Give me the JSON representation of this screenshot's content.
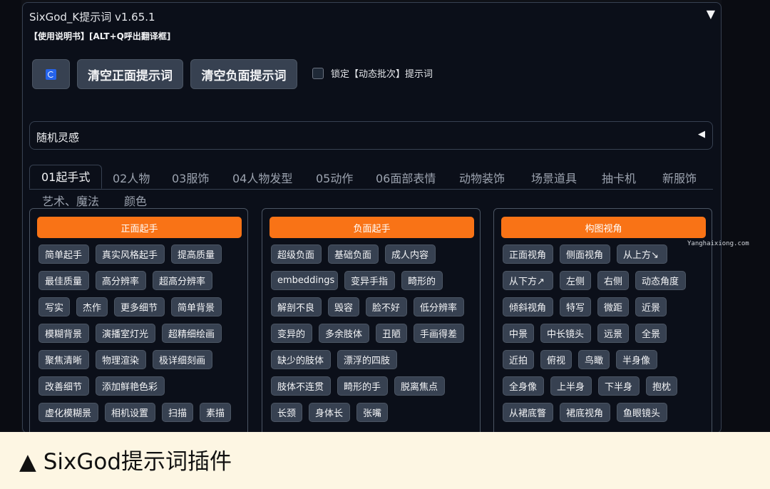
{
  "panel": {
    "title": "SixGod_K提示词 v1.65.1",
    "toggle_icon": "▼",
    "manual": "【使用说明书】[ALT+Q呼出翻译框]"
  },
  "toolbar": {
    "refresh_icon": "refresh-icon",
    "clear_positive": "清空正面提示词",
    "clear_negative": "清空负面提示词",
    "lock_label": "锁定【动态批次】提示词"
  },
  "random": {
    "label": "随机灵感",
    "arrow": "◀"
  },
  "tabs": [
    {
      "label": "01起手式"
    },
    {
      "label": "02人物"
    },
    {
      "label": "03服饰"
    },
    {
      "label": "04人物发型"
    },
    {
      "label": "05动作"
    },
    {
      "label": "06面部表情"
    },
    {
      "label": "动物装饰"
    },
    {
      "label": "场景道具"
    },
    {
      "label": "抽卡机"
    },
    {
      "label": "新服饰"
    },
    {
      "label": "艺术、魔法"
    },
    {
      "label": "颜色"
    }
  ],
  "cards": [
    {
      "header": "正面起手",
      "chips": [
        "简单起手",
        "真实风格起手",
        "提高质量",
        "最佳质量",
        "高分辨率",
        "超高分辨率",
        "写实",
        "杰作",
        "更多细节",
        "简单背景",
        "模糊背景",
        "演播室灯光",
        "超精细绘画",
        "聚焦清晰",
        "物理渲染",
        "极详细刻画",
        "改善细节",
        "添加鲜艳色彩",
        "虚化模糊景",
        "相机设置",
        "扫描",
        "素描"
      ]
    },
    {
      "header": "负面起手",
      "chips": [
        "超级负面",
        "基础负面",
        "成人内容",
        "embeddings",
        "变异手指",
        "畸形的",
        "解剖不良",
        "毁容",
        "脸不好",
        "低分辨率",
        "变异的",
        "多余肢体",
        "丑陋",
        "手画得差",
        "缺少的肢体",
        "漂浮的四肢",
        "肢体不连贯",
        "畸形的手",
        "脱离焦点",
        "长颈",
        "身体长",
        "张嘴"
      ]
    },
    {
      "header": "构图视角",
      "chips": [
        "正面视角",
        "侧面视角",
        "从上方↘",
        "从下方↗",
        "左侧",
        "右侧",
        "动态角度",
        "倾斜视角",
        "特写",
        "微距",
        "近景",
        "中景",
        "中长镜头",
        "远景",
        "全景",
        "近拍",
        "俯视",
        "鸟瞰",
        "半身像",
        "全身像",
        "上半身",
        "下半身",
        "抱枕",
        "从裙底瞥",
        "裙底视角",
        "鱼眼镜头"
      ]
    }
  ],
  "watermark": "Yanghaixiong.com",
  "caption": "▲ SixGod提示词插件"
}
